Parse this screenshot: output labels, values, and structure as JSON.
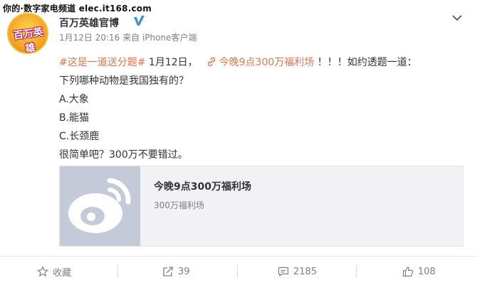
{
  "watermark": "你的·数字家电频道 elec.it168.com",
  "author": {
    "name": "百万英雄官博",
    "avatar_text": "百万英雄"
  },
  "meta": {
    "date": "1月12日 20:16",
    "source": "来自 iPhone客户端"
  },
  "post": {
    "topic": "#这是一道送分题#",
    "date_text": " 1月12日，",
    "link_text": "今晚9点300万福利场",
    "after_link": " ！！！如约透题一道：",
    "question": "下列哪种动物是我国独有的？",
    "options": [
      "A.大象",
      "B.能猫",
      "C.长颈鹿"
    ],
    "closing": "很简单吧？300万不要错过。"
  },
  "card": {
    "title": "今晚9点300万福利场",
    "subtitle": "300万福利场"
  },
  "actions": {
    "favorite": "收藏",
    "repost": "39",
    "comment": "2185",
    "like": "108"
  },
  "colors": {
    "accent": "#eb7350",
    "verified": "#3d8fd6",
    "muted": "#808080"
  }
}
